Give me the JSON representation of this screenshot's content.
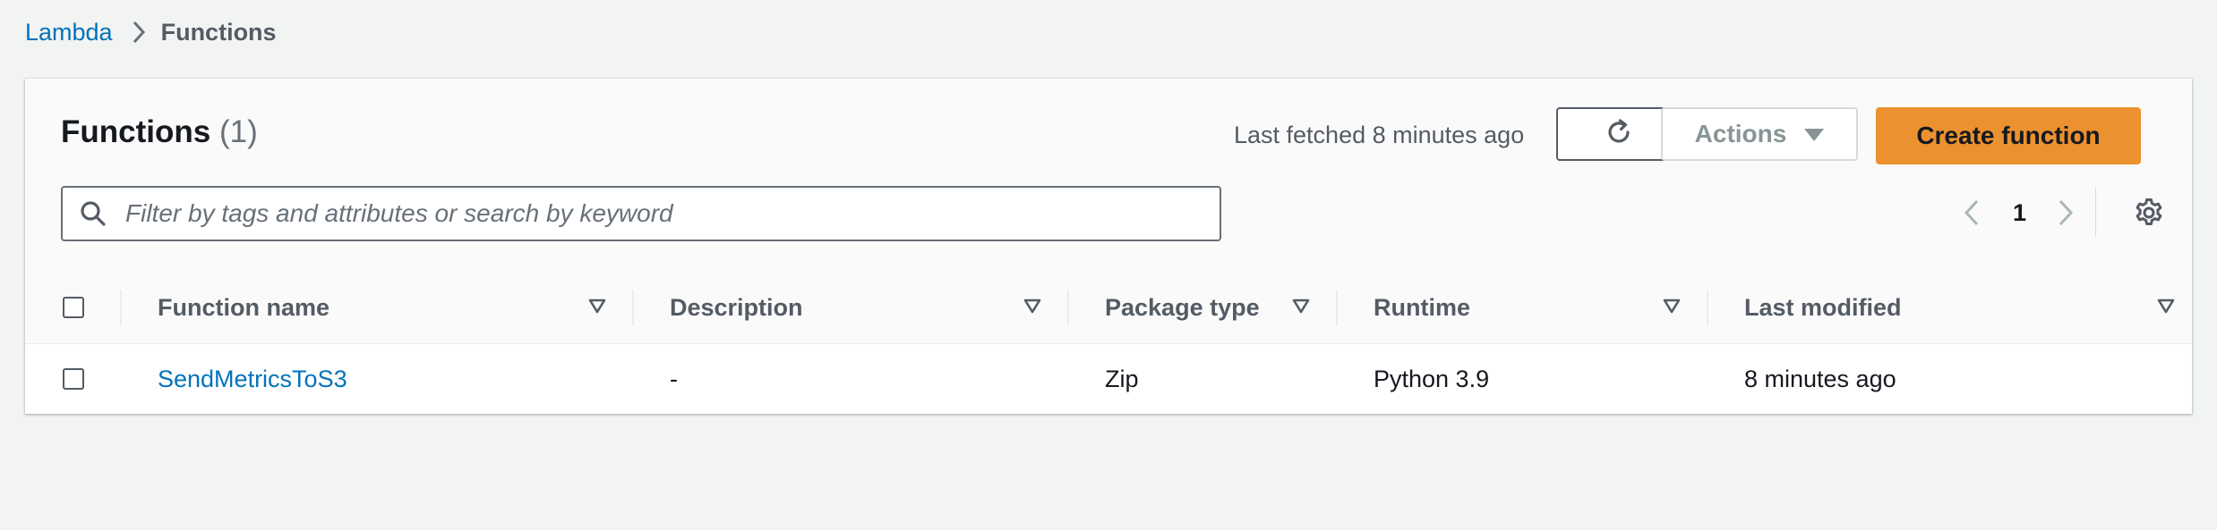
{
  "breadcrumb": {
    "parent": "Lambda",
    "current": "Functions"
  },
  "panel": {
    "title": "Functions",
    "count": "(1)",
    "last_fetched": "Last fetched 8 minutes ago",
    "actions_label": "Actions",
    "create_label": "Create function",
    "search_placeholder": "Filter by tags and attributes or search by keyword",
    "search_value": "",
    "page_number": "1"
  },
  "table": {
    "columns": [
      {
        "label": "Function name"
      },
      {
        "label": "Description"
      },
      {
        "label": "Package type"
      },
      {
        "label": "Runtime"
      },
      {
        "label": "Last modified"
      }
    ],
    "rows": [
      {
        "function_name": "SendMetricsToS3",
        "description": "-",
        "package_type": "Zip",
        "runtime": "Python 3.9",
        "last_modified": "8 minutes ago",
        "selected": false
      }
    ]
  },
  "icons": {
    "breadcrumb_separator": "chevron-right-icon",
    "refresh": "refresh-icon",
    "actions_caret": "caret-down-icon",
    "search": "search-icon",
    "prev_page": "chevron-left-icon",
    "next_page": "chevron-right-icon",
    "settings": "gear-icon",
    "sort": "sort-caret-icon"
  },
  "colors": {
    "page_background": "#f2f3f3",
    "link": "#0073bb",
    "primary_button": "#ec912f",
    "text": "#16191f",
    "muted_text": "#545b64",
    "disabled": "#879596"
  }
}
